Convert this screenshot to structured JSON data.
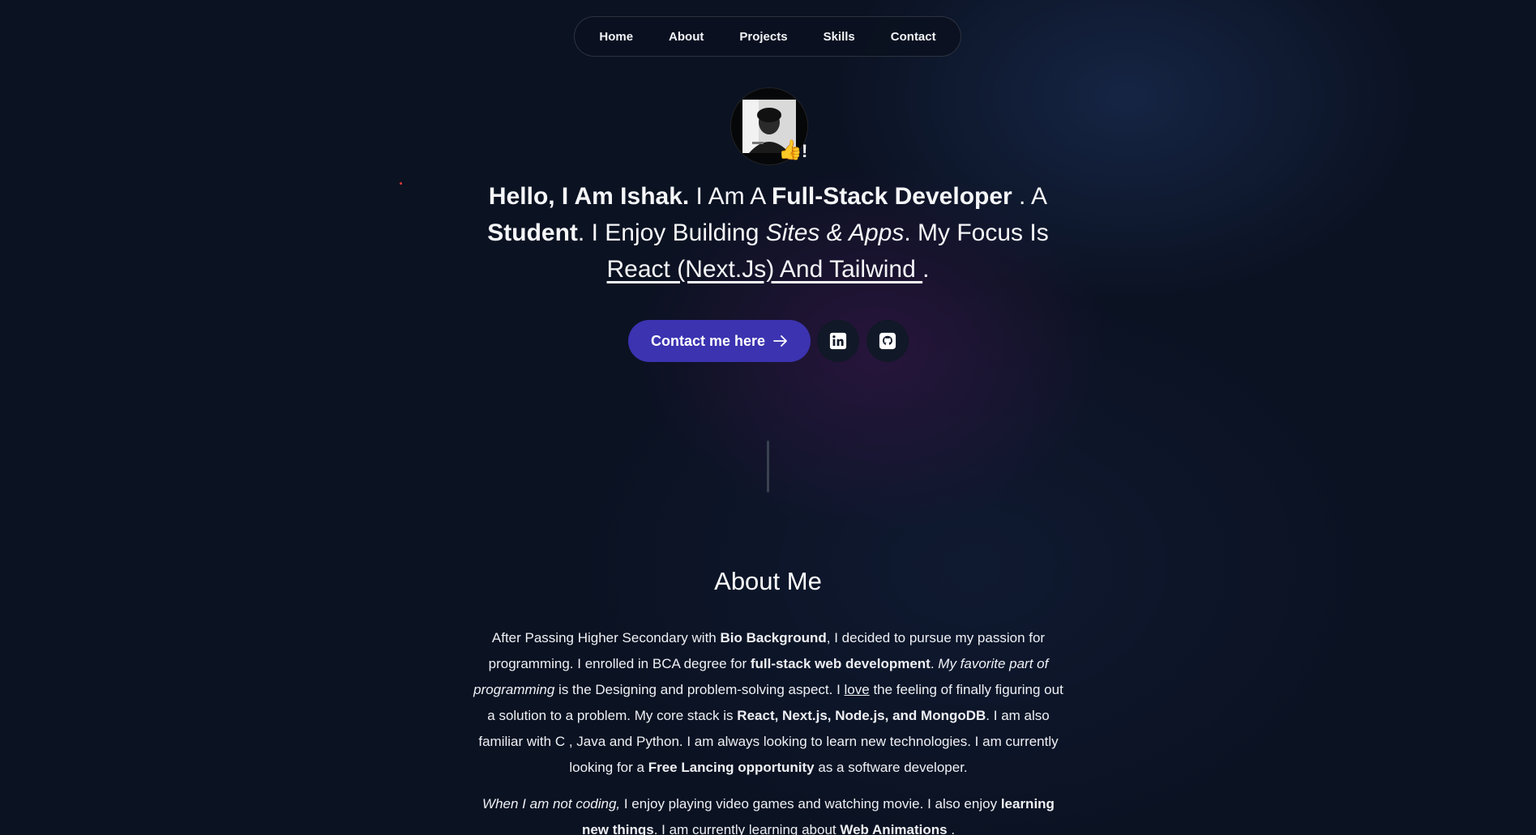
{
  "nav": {
    "items": [
      {
        "label": "Home"
      },
      {
        "label": "About"
      },
      {
        "label": "Projects"
      },
      {
        "label": "Skills"
      },
      {
        "label": "Contact"
      }
    ]
  },
  "hero": {
    "wave_emoji": "👍",
    "wave_suffix": "!",
    "greeting": "Hello, I Am Ishak.",
    "t1": " I Am A ",
    "role": "Full-Stack Developer",
    "t2": " . A ",
    "student": "Student",
    "t3": ". I Enjoy Building ",
    "sites": "Sites & Apps",
    "t4": ". My Focus Is ",
    "focus": "React (Next.Js) And Tailwind ",
    "t5": "."
  },
  "cta": {
    "label": "Contact me here",
    "arrow_icon": "arrow-right-icon",
    "color": "#3b33b0"
  },
  "social": {
    "linkedin_icon": "linkedin-icon",
    "github_icon": "github-icon"
  },
  "about": {
    "title": "About Me",
    "p1": {
      "a": "After Passing Higher Secondary with ",
      "b_bio": "Bio Background",
      "c": ", I decided to pursue my passion for programming. I enrolled in BCA degree for ",
      "b_fullstack": "full-stack web development",
      "d": ". ",
      "i_fav": "My favorite part of programming",
      "e": " is the Designing and problem-solving aspect. I ",
      "u_love": "love",
      "f": " the feeling of finally figuring out a solution to a problem. My core stack is ",
      "b_stack": "React, Next.js, Node.js, and MongoDB",
      "g": ". I am also familiar with C , Java and Python. I am always looking to learn new technologies. I am currently looking for a ",
      "b_free": "Free Lancing opportunity",
      "h": " as a software developer."
    },
    "p2": {
      "i_when": "When I am not coding,",
      "a": " I enjoy playing video games and watching movie. I also enjoy ",
      "b_learning": "learning new things",
      "b": ". I am currently learning about ",
      "b_web": "Web Animations",
      "c": " ."
    }
  }
}
